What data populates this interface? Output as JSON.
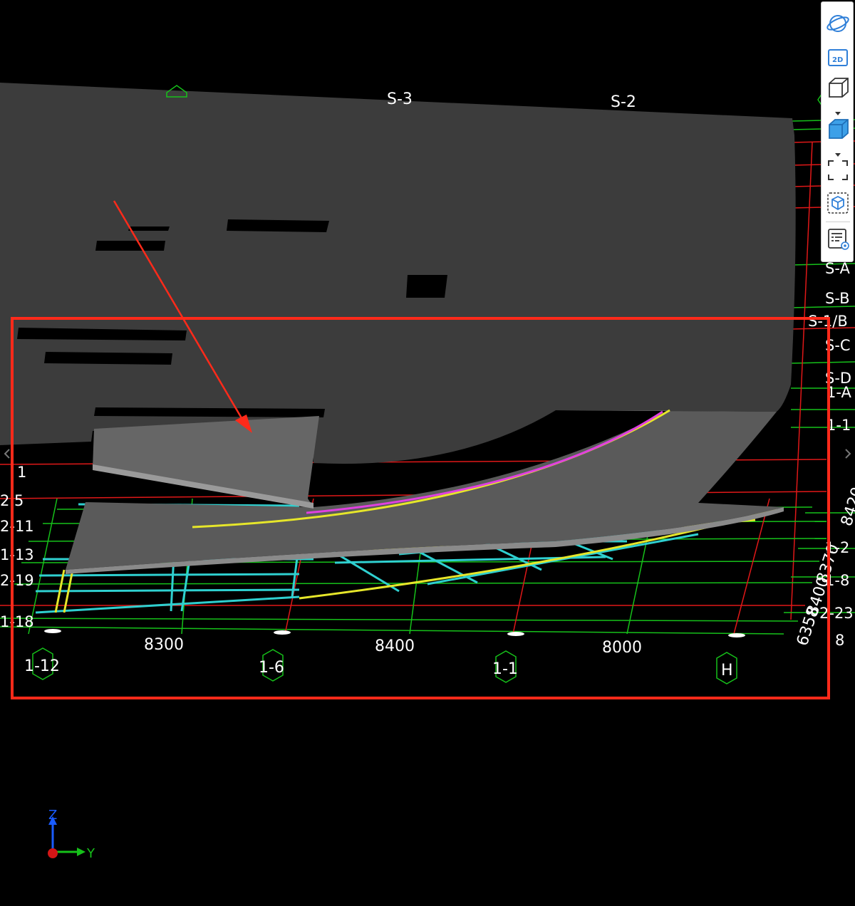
{
  "toolbar": {
    "items": [
      {
        "name": "orbit",
        "icon": "orbit-icon"
      },
      {
        "name": "2d",
        "icon": "2d-view-icon",
        "label": "2D"
      },
      {
        "name": "3d-wireframe",
        "icon": "cube-outline-icon"
      },
      {
        "name": "3d-shaded",
        "icon": "cube-shaded-icon"
      },
      {
        "name": "fit-view",
        "icon": "fit-view-icon"
      },
      {
        "name": "section-box",
        "icon": "section-box-icon"
      },
      {
        "name": "properties",
        "icon": "properties-icon"
      }
    ]
  },
  "grid": {
    "top_axes": [
      "S-3",
      "S-2"
    ],
    "bottom_axes": [
      "1-12",
      "1-6",
      "1-1",
      "H"
    ],
    "dimensions": [
      "8300",
      "8400",
      "8000"
    ],
    "left_labels": [
      "1",
      "2.5",
      "2-11",
      "1-13",
      "2-19",
      "1-18"
    ],
    "right_labels": [
      "S-A",
      "S-B",
      "S-1/B",
      "S-C",
      "S-D",
      "1-A",
      "1-1",
      "1-2",
      "1-8",
      "2-23",
      "8"
    ],
    "right_dims": [
      "6358",
      "8400",
      "8370",
      "8420"
    ]
  },
  "axis_indicator": {
    "z_label": "Z",
    "y_label": "Y"
  },
  "colors": {
    "background": "#000000",
    "slab": "#3c3c3c",
    "grid_green": "#16c11a",
    "grid_red": "#e01818",
    "beam_cyan": "#2fd0d0",
    "beam_yellow": "#e6e62a",
    "beam_magenta": "#e040e0",
    "annotation_red": "#ff2a1a"
  }
}
